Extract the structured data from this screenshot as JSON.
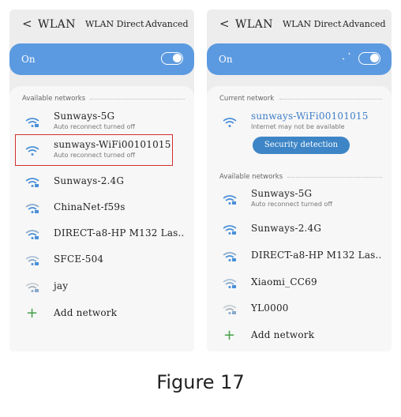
{
  "left": {
    "header": {
      "back": "<",
      "title": "WLAN",
      "direct": "WLAN Direct",
      "advanced": "Advanced"
    },
    "switch": {
      "label": "On"
    },
    "section": "Available networks",
    "networks": [
      {
        "name": "Sunways-5G",
        "sub": "Auto reconnect turned off"
      },
      {
        "name": "sunways-WiFi00101015",
        "sub": "Auto reconnect turned off"
      },
      {
        "name": "Sunways-2.4G"
      },
      {
        "name": "ChinaNet-f59s"
      },
      {
        "name": "DIRECT-a8-HP M132 Las.."
      },
      {
        "name": "SFCE-504"
      },
      {
        "name": "jay"
      }
    ],
    "add": "Add network"
  },
  "right": {
    "header": {
      "back": "<",
      "title": "WLAN",
      "direct": "WLAN Direct",
      "advanced": "Advanced"
    },
    "switch": {
      "label": "On"
    },
    "current_section": "Current network",
    "current": {
      "name": "sunways-WiFi00101015",
      "sub": "Internet may not be available",
      "button": "Security detection"
    },
    "section": "Available networks",
    "networks": [
      {
        "name": "Sunways-5G",
        "sub": "Auto reconnect turned off"
      },
      {
        "name": "Sunways-2.4G"
      },
      {
        "name": "DIRECT-a8-HP M132 Las.."
      },
      {
        "name": "Xiaomi_CC69"
      },
      {
        "name": "YL0000"
      }
    ],
    "add": "Add network"
  },
  "caption": "Figure 17",
  "colors": {
    "accent": "#5b9ae0",
    "button": "#3d85c6",
    "highlight": "#d32f2f",
    "add": "#43a047"
  }
}
